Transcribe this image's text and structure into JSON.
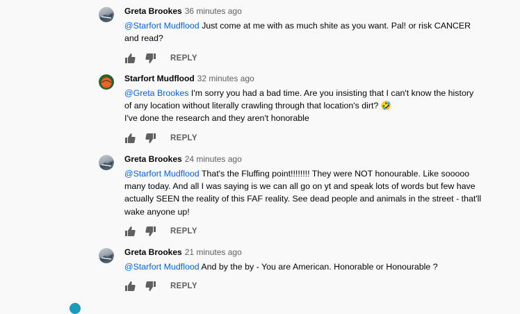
{
  "comments": [
    {
      "author": "Greta Brookes",
      "time": "36 minutes ago",
      "mention": "@Starfort Mudflood",
      "lines": [
        " Just come at me with as much shite as you want. Pal! or risk CANCER",
        "and read?"
      ],
      "reply_label": "REPLY"
    },
    {
      "author": "Starfort Mudflood",
      "time": "32 minutes ago",
      "mention": "@Greta Brookes",
      "lines": [
        " I'm sorry you had a bad time.  Are you insisting that I can't know the history",
        "of any location without literally crawling through that location's dirt? 🤣",
        "I've done the research and they aren't honorable"
      ],
      "reply_label": "REPLY"
    },
    {
      "author": "Greta Brookes",
      "time": "24 minutes ago",
      "mention": "@Starfort Mudflood",
      "lines": [
        " That's the Fluffing point!!!!!!!! They were NOT honourable. Like sooooo",
        "many today. And all I was saying is we can all go on yt and speak lots of words but few have",
        "actually SEEN the reality of this FAF reality. See dead people and animals in the street - that'll",
        "wake anyone up!"
      ],
      "reply_label": "REPLY"
    },
    {
      "author": "Greta Brookes",
      "time": "21 minutes ago",
      "mention": "@Starfort Mudflood",
      "lines": [
        " And by the by - You are American. Honorable or Honourable ?"
      ],
      "reply_label": "REPLY"
    }
  ],
  "icons": {
    "like": "thumbs-up-icon",
    "dislike": "thumbs-down-icon"
  },
  "colors": {
    "mention": "#065fd4",
    "secondary_text": "#606060",
    "background": "#f9f9f9"
  }
}
